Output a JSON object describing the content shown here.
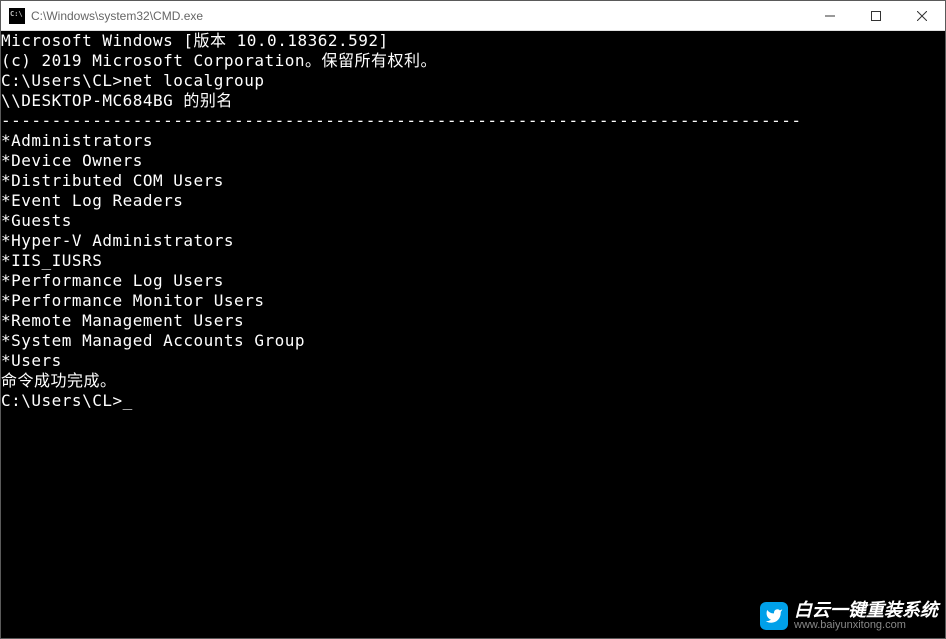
{
  "titlebar": {
    "title": "C:\\Windows\\system32\\CMD.exe"
  },
  "terminal": {
    "header1": "Microsoft Windows [版本 10.0.18362.592]",
    "header2": "(c) 2019 Microsoft Corporation。保留所有权利。",
    "blank1": "",
    "prompt1_path": "C:\\Users\\CL>",
    "prompt1_cmd": "net localgroup",
    "blank2": "",
    "alias_line": "\\\\DESKTOP-MC684BG 的别名",
    "blank3": "",
    "divider": "-------------------------------------------------------------------------------",
    "groups": [
      "*Administrators",
      "*Device Owners",
      "*Distributed COM Users",
      "*Event Log Readers",
      "*Guests",
      "*Hyper-V Administrators",
      "*IIS_IUSRS",
      "*Performance Log Users",
      "*Performance Monitor Users",
      "*Remote Management Users",
      "*System Managed Accounts Group",
      "*Users"
    ],
    "success": "命令成功完成。",
    "blank4": "",
    "blank5": "",
    "prompt2_path": "C:\\Users\\CL>",
    "cursor": "_"
  },
  "watermark": {
    "main": "白云一键重装系统",
    "sub": "www.baiyunxitong.com"
  }
}
